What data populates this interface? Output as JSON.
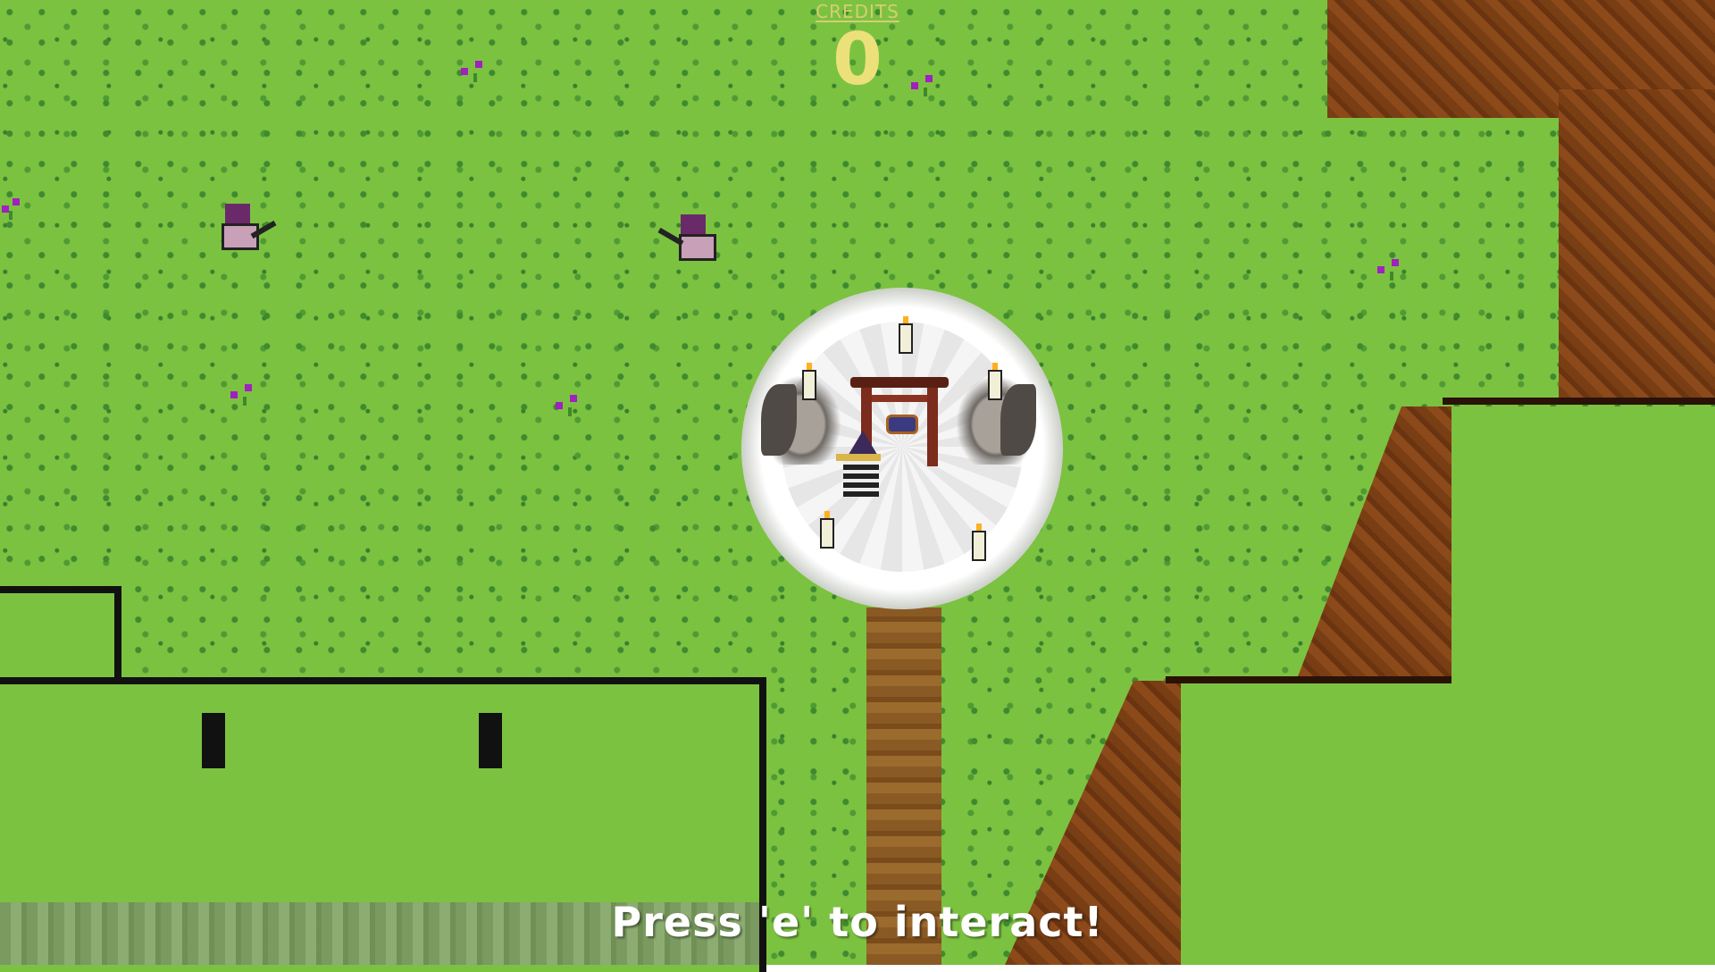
{
  "hud": {
    "credits_label": "CREDITS",
    "credits_value": "0"
  },
  "prompt": {
    "text": "Press 'e' to interact!"
  },
  "scene": {
    "icons": [
      "enemy-sprite",
      "player-sprite",
      "shrine-altar",
      "torii-gate",
      "gargoyle-statue",
      "candle",
      "flower"
    ],
    "colors": {
      "grass": "#7cc241",
      "dirt": "#7a3e14",
      "credits_text": "#ece07a",
      "prompt_text": "#ffffff"
    }
  }
}
